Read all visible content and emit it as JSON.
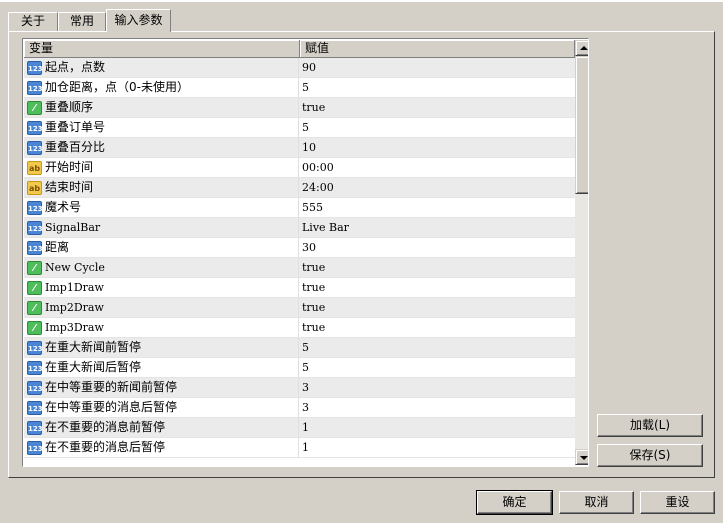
{
  "tabs": [
    {
      "label": "关于"
    },
    {
      "label": "常用"
    },
    {
      "label": "输入参数",
      "active": true
    }
  ],
  "grid": {
    "headers": {
      "variable": "变量",
      "value": "赋值"
    },
    "rows": [
      {
        "icon": "number-type-icon",
        "badge": "123",
        "name": "起点，点数",
        "value": "90"
      },
      {
        "icon": "number-type-icon",
        "badge": "123",
        "name": "加仓距离，点（0-未使用）",
        "value": "5"
      },
      {
        "icon": "bool-type-icon",
        "badge": "⁄",
        "name": "重叠顺序",
        "value": "true"
      },
      {
        "icon": "number-type-icon",
        "badge": "123",
        "name": "重叠订单号",
        "value": "5"
      },
      {
        "icon": "number-type-icon",
        "badge": "123",
        "name": "重叠百分比",
        "value": "10"
      },
      {
        "icon": "string-type-icon",
        "badge": "ab",
        "name": "开始时间",
        "value": "00:00"
      },
      {
        "icon": "string-type-icon",
        "badge": "ab",
        "name": "结束时间",
        "value": "24:00"
      },
      {
        "icon": "number-type-icon",
        "badge": "123",
        "name": "魔术号",
        "value": "555"
      },
      {
        "icon": "number-type-icon",
        "badge": "123",
        "name": "SignalBar",
        "value": "Live Bar"
      },
      {
        "icon": "number-type-icon",
        "badge": "123",
        "name": "距离",
        "value": "30"
      },
      {
        "icon": "bool-type-icon",
        "badge": "⁄",
        "name": "New Cycle",
        "value": "true"
      },
      {
        "icon": "bool-type-icon",
        "badge": "⁄",
        "name": "Imp1Draw",
        "value": "true"
      },
      {
        "icon": "bool-type-icon",
        "badge": "⁄",
        "name": "Imp2Draw",
        "value": "true"
      },
      {
        "icon": "bool-type-icon",
        "badge": "⁄",
        "name": "Imp3Draw",
        "value": "true"
      },
      {
        "icon": "number-type-icon",
        "badge": "123",
        "name": "在重大新闻前暂停",
        "value": "5"
      },
      {
        "icon": "number-type-icon",
        "badge": "123",
        "name": "在重大新闻后暂停",
        "value": "5"
      },
      {
        "icon": "number-type-icon",
        "badge": "123",
        "name": "在中等重要的新闻前暂停",
        "value": "3"
      },
      {
        "icon": "number-type-icon",
        "badge": "123",
        "name": "在中等重要的消息后暂停",
        "value": "3"
      },
      {
        "icon": "number-type-icon",
        "badge": "123",
        "name": "在不重要的消息前暂停",
        "value": "1"
      },
      {
        "icon": "number-type-icon",
        "badge": "123",
        "name": "在不重要的消息后暂停",
        "value": "1"
      }
    ]
  },
  "side_buttons": {
    "load": "加载(L)",
    "save": "保存(S)"
  },
  "dialog_buttons": {
    "ok": "确定",
    "cancel": "取消",
    "reset": "重设"
  }
}
